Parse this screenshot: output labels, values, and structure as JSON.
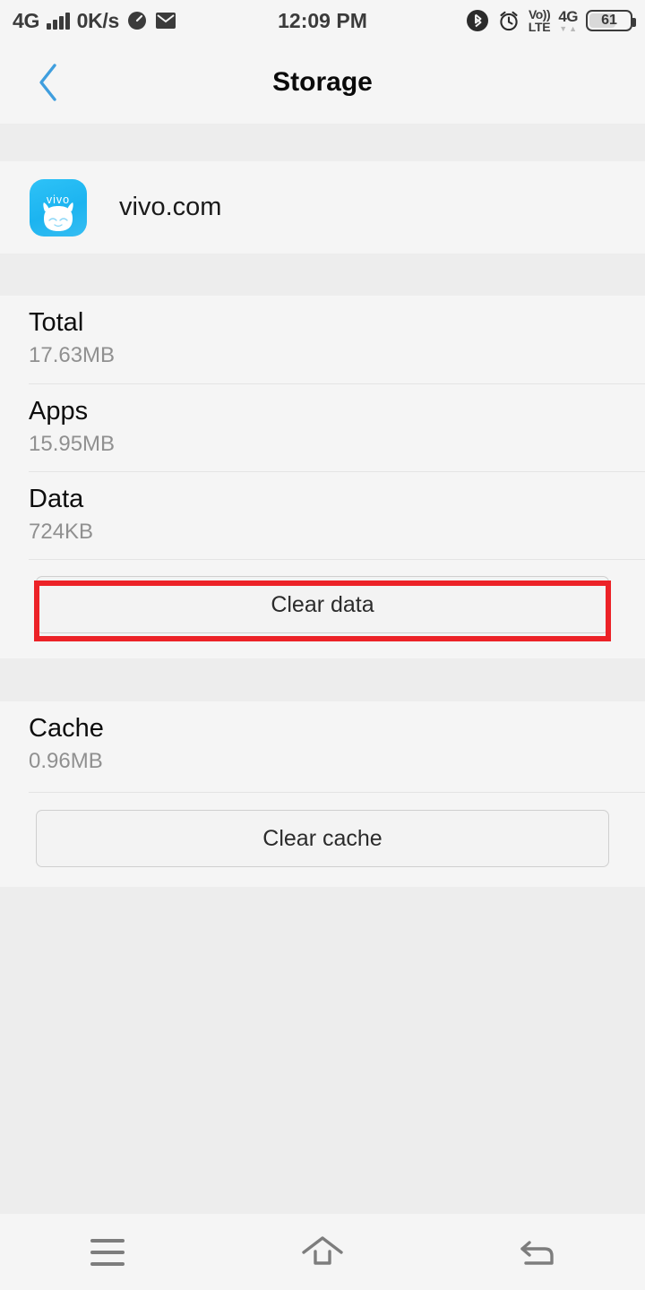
{
  "statusbar": {
    "network_type": "4G",
    "data_rate": "0K/s",
    "signal_icon": "signal-bars-icon",
    "speed_icon": "speedometer-icon",
    "mail_icon": "mail-icon",
    "time": "12:09 PM",
    "bluetooth_icon": "bluetooth-icon",
    "alarm_icon": "alarm-clock-icon",
    "volte_line1": "Vo))",
    "volte_line2": "LTE",
    "network_badge": "4G",
    "data_arrow_down": "▼",
    "data_arrow_up": "▲",
    "battery_level": "61",
    "battery_icon": "battery-icon"
  },
  "header": {
    "title": "Storage",
    "back_icon": "back-chevron-icon",
    "back_color": "#3f9ede"
  },
  "app": {
    "name": "vivo.com",
    "icon_name": "vivo-app-icon",
    "icon_wordmark": "vivo",
    "icon_color": "#1cb4f0"
  },
  "storage": {
    "rows": [
      {
        "label": "Total",
        "value": "17.63MB"
      },
      {
        "label": "Apps",
        "value": "15.95MB"
      },
      {
        "label": "Data",
        "value": "724KB"
      }
    ],
    "clear_data_label": "Clear data"
  },
  "cache": {
    "label": "Cache",
    "value": "0.96MB",
    "clear_cache_label": "Clear cache"
  },
  "annotation": {
    "color": "#ec2227",
    "target": "clear-data-button"
  },
  "navbar": {
    "menu_icon": "menu-icon",
    "home_icon": "home-icon",
    "back_icon": "back-arrow-icon"
  }
}
